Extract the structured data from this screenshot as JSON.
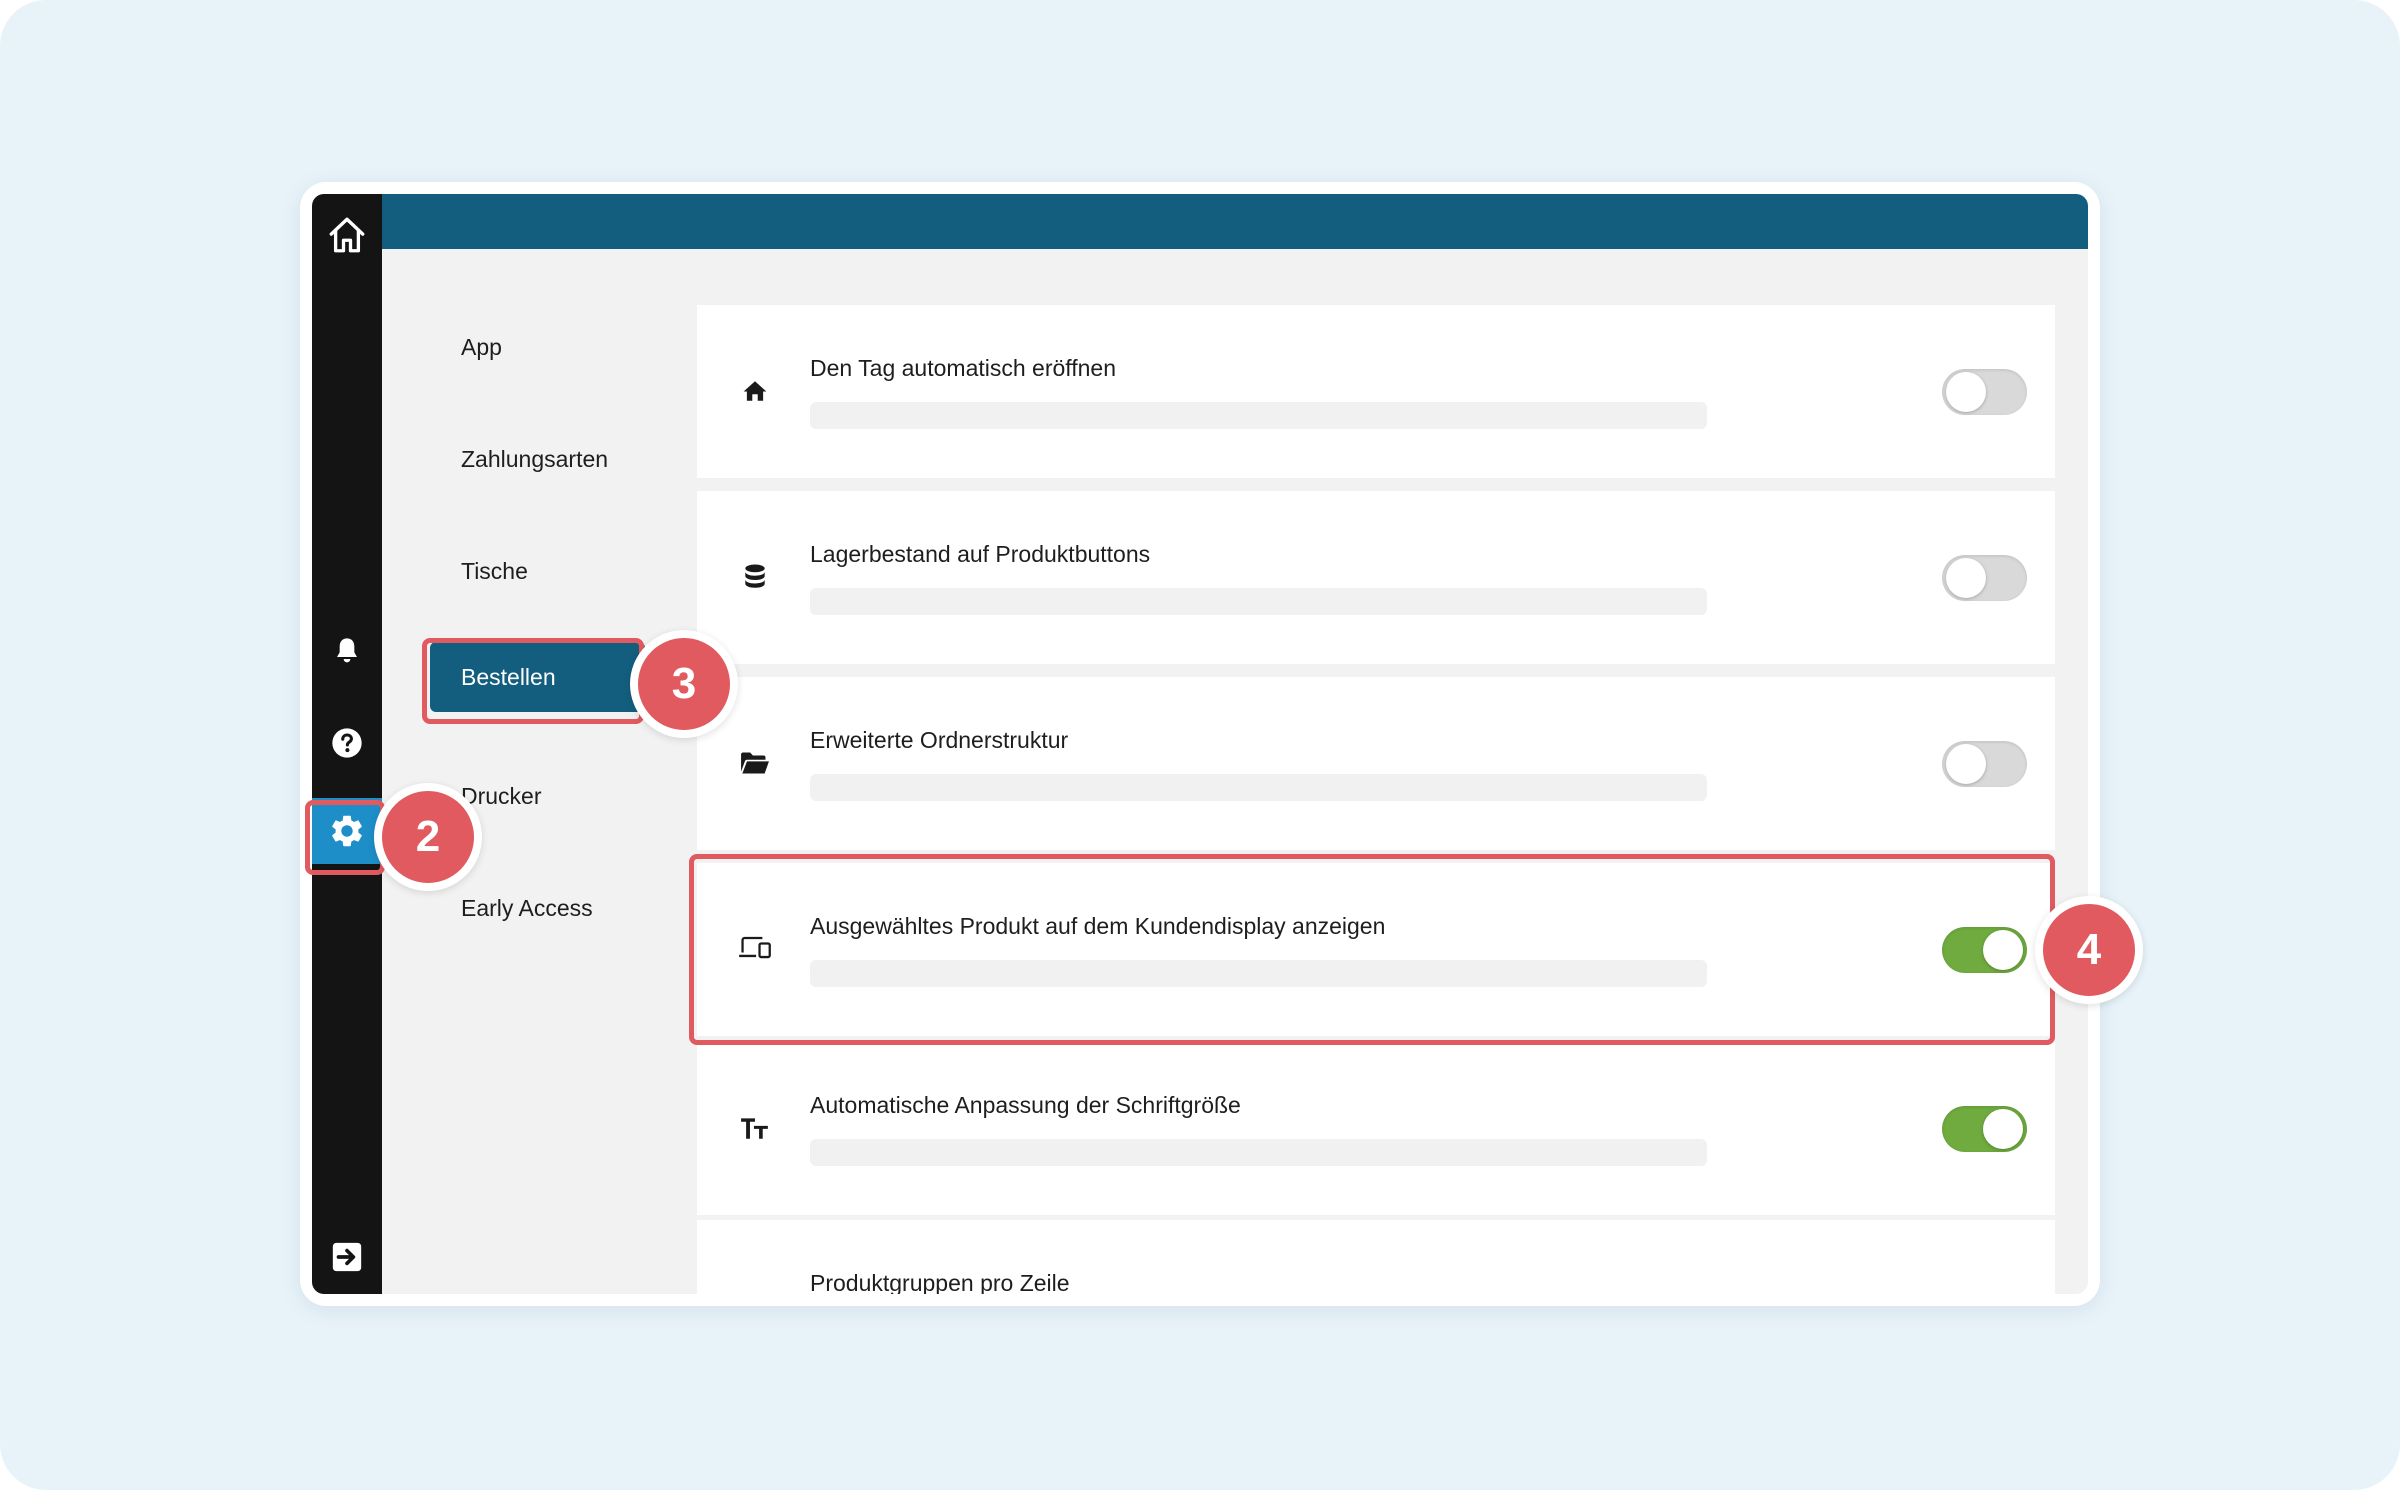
{
  "sidebar": {
    "icons": [
      "home-icon",
      "bell-icon",
      "help-icon",
      "gear-icon",
      "logout-icon"
    ],
    "active": "settings"
  },
  "settings_menu": {
    "items": [
      {
        "label": "App"
      },
      {
        "label": "Zahlungsarten"
      },
      {
        "label": "Tische"
      },
      {
        "label": "Bestellen",
        "active": true
      },
      {
        "label": "Drucker"
      },
      {
        "label": "Early Access"
      }
    ]
  },
  "settings": {
    "rows": [
      {
        "title": "Den Tag automatisch eröffnen",
        "icon": "home-icon",
        "enabled": false
      },
      {
        "title": "Lagerbestand auf Produktbuttons",
        "icon": "database-icon",
        "enabled": false
      },
      {
        "title": "Erweiterte Ordnerstruktur",
        "icon": "folder-open-icon",
        "enabled": false
      },
      {
        "title": "Ausgewähltes Produkt auf dem Kundendisplay anzeigen",
        "icon": "devices-icon",
        "enabled": true
      },
      {
        "title": "Automatische Anpassung der Schriftgröße",
        "icon": "text-size-icon",
        "enabled": true
      },
      {
        "title": "Produktgruppen pro Zeile"
      }
    ]
  },
  "annotations": {
    "step2": "2",
    "step3": "3",
    "step4": "4"
  },
  "colors": {
    "header": "#135e7e",
    "rail": "#141414",
    "active_rail_item": "#1e8ec8",
    "toggle_on": "#6fab3f",
    "toggle_off": "#d9d9d9",
    "highlight": "#e05a5f",
    "background": "#e8f3f9"
  }
}
